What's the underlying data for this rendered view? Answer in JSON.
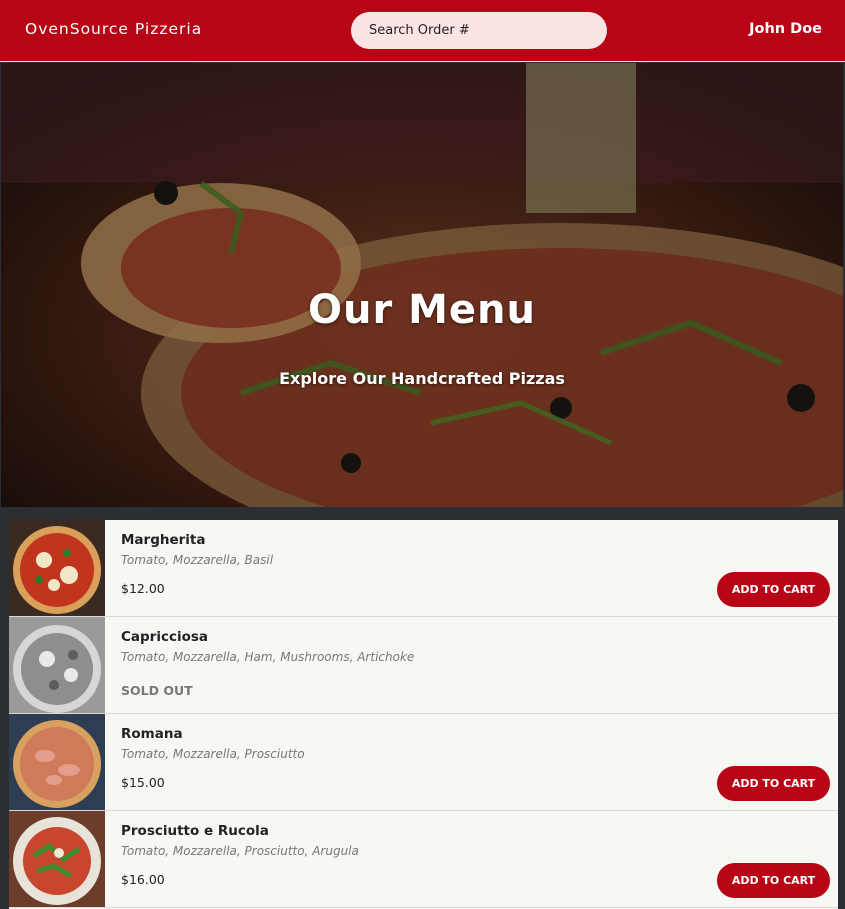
{
  "header": {
    "brand": "OvenSource Pizzeria",
    "search_placeholder": "Search Order #",
    "user_name": "John Doe"
  },
  "hero": {
    "title": "Our Menu",
    "subtitle": "Explore Our Handcrafted Pizzas"
  },
  "menu": {
    "items": [
      {
        "name": "Margherita",
        "ingredients": "Tomato, Mozzarella, Basil",
        "price": "$12.00",
        "button": "ADD TO CART"
      },
      {
        "name": "Capricciosa",
        "ingredients": "Tomato, Mozzarella, Ham, Mushrooms, Artichoke",
        "status": "SOLD OUT"
      },
      {
        "name": "Romana",
        "ingredients": "Tomato, Mozzarella, Prosciutto",
        "price": "$15.00",
        "button": "ADD TO CART"
      },
      {
        "name": "Prosciutto e Rucola",
        "ingredients": "Tomato, Mozzarella, Prosciutto, Arugula",
        "price": "$16.00",
        "button": "ADD TO CART"
      }
    ]
  },
  "colors": {
    "brand_red": "#b70516",
    "search_bg": "#fde4e4",
    "menu_bg": "#f7f8f4",
    "page_bg": "#2b2f33"
  }
}
